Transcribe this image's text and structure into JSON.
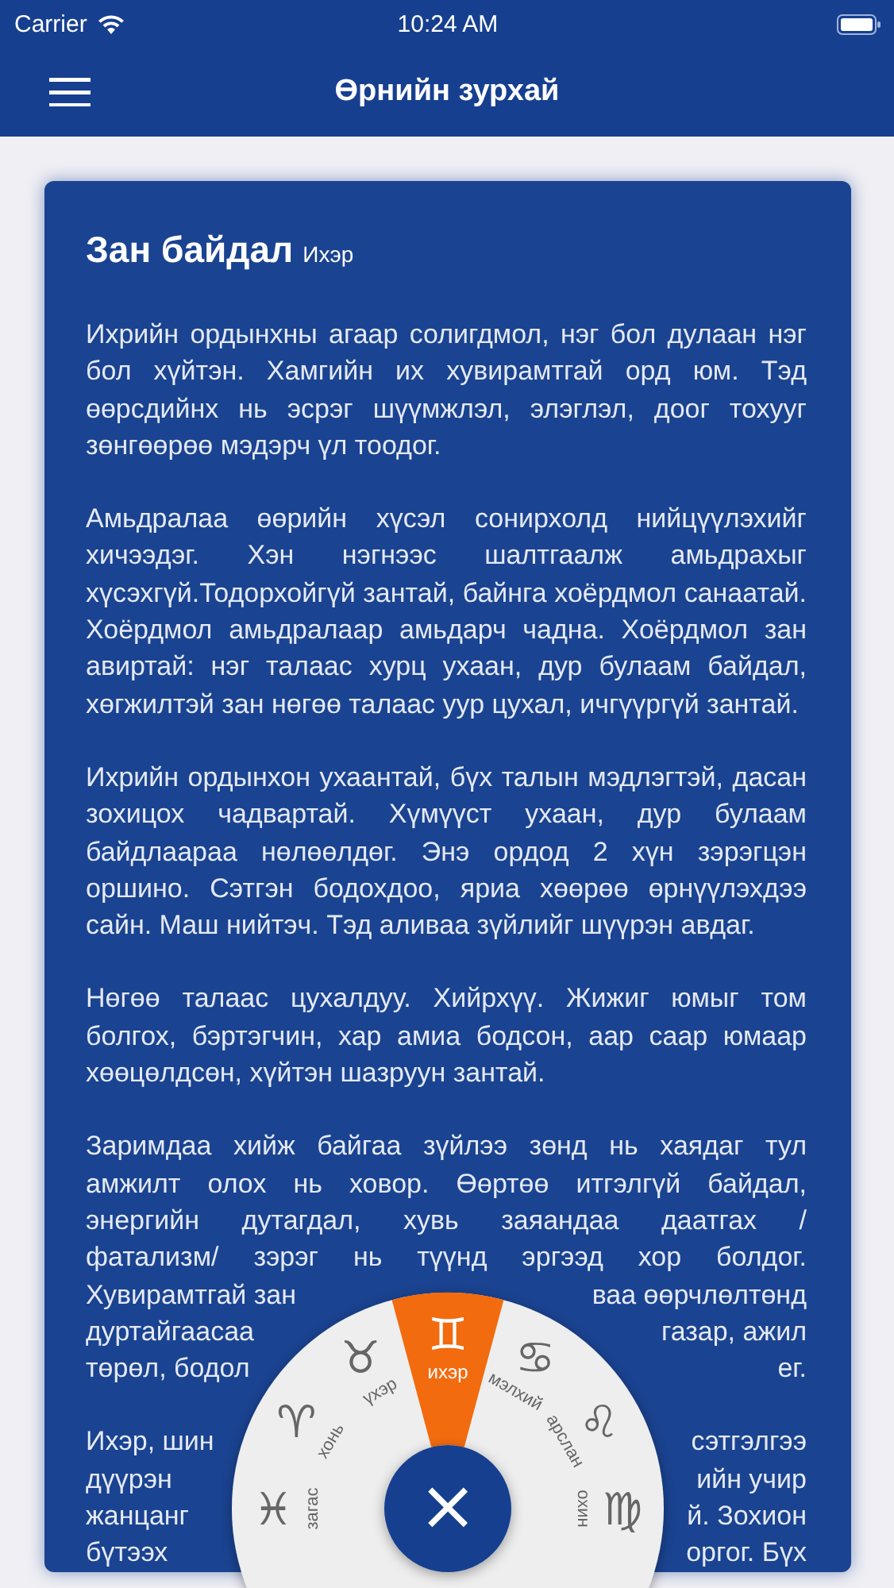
{
  "status_bar": {
    "carrier": "Carrier",
    "time": "10:24 AM"
  },
  "nav_bar": {
    "title": "Өрнийн зурхай"
  },
  "card": {
    "title": "Зан байдал",
    "subtitle": "Ихэр",
    "paragraphs": [
      {
        "kind": "text",
        "text": "Ихрийн ордынхны агаар солигдмол, нэг бол дулаан нэг бол хүйтэн. Хамгийн их хувирамтгай орд юм. Тэд өөрсдийнх нь эсрэг шүүмжлэл, элэглэл, доог тохууг зөнгөөрөө мэдэрч үл тоодог."
      },
      {
        "kind": "text",
        "text": "Амьдралаа өөрийн хүсэл сонирхолд нийцүүлэхийг хичээдэг. Хэн нэгнээс шалтгаалж амьдрахыг хүсэхгүй.Тодорхойгүй зантай, байнга хоёрдмол санаатай. Хоёрдмол амьдралаар амьдарч чадна. Хоёрдмол зан авиртай: нэг талаас хурц ухаан, дур булаам байдал, хөгжилтэй зан нөгөө талаас уур цухал, ичгүүргүй зантай."
      },
      {
        "kind": "text",
        "text": "Ихрийн ордынхон ухаантай, бүх талын мэдлэгтэй, дасан зохицох чадвартай. Хүмүүст ухаан, дур булаам байдлаараа нөлөөлдөг. Энэ ордод 2 хүн зэрэгцэн оршино. Сэтгэн бодохдоо, яриа хөөрөө өрнүүлэхдээ сайн. Маш нийтэч. Тэд аливаа зүйлийг шүүрэн авдаг."
      },
      {
        "kind": "text",
        "text": "Нөгөө талаас цухалдуу. Хийрхүү. Жижиг юмыг том болгох, бэртэгчин, хар амиа бодсон, аар саар юмаар хөөцөлдсөн, хүйтэн шазруун зантай."
      },
      {
        "kind": "lines",
        "lines": [
          {
            "text": "Заримдаа хийж байгаа зүйлээ зөнд нь хаядаг тул"
          },
          {
            "text": "амжилт олох нь ховор. Өөртөө итгэлгүй байдал,"
          },
          {
            "text": "энергийн дутагдал, хувь заяандаа даатгах /"
          },
          {
            "text": "фатализм/ зэрэг нь түүнд эргээд хор болдог."
          },
          {
            "left": "Хувирамтгай зан",
            "right": "ваа өөрчлөлтөнд"
          },
          {
            "left": "дуртайгаасаа",
            "right": "газар, ажил"
          },
          {
            "left": "төрөл, бодол",
            "right": "ег."
          }
        ]
      },
      {
        "kind": "lines",
        "lines": [
          {
            "left": "Ихэр, шин",
            "right": "сэтгэлгээ"
          },
          {
            "left": "дүүрэн",
            "right": "ийн учир"
          },
          {
            "left": "жанцанг",
            "right": "й. Зохион"
          },
          {
            "left": "бүтээх",
            "right": "оргог. Бүх"
          }
        ]
      }
    ]
  },
  "zodiac_wheel": {
    "close_symbol": "×",
    "signs": [
      {
        "glyph": "♓",
        "label": "загас",
        "selected": false
      },
      {
        "glyph": "♈",
        "label": "хонь",
        "selected": false
      },
      {
        "glyph": "♉",
        "label": "үхэр",
        "selected": false
      },
      {
        "glyph": "♊",
        "label": "ихэр",
        "selected": true
      },
      {
        "glyph": "♋",
        "label": "мэлхий",
        "selected": false
      },
      {
        "glyph": "♌",
        "label": "арслан",
        "selected": false
      },
      {
        "glyph": "♍",
        "label": "охин",
        "selected": false
      }
    ]
  }
}
